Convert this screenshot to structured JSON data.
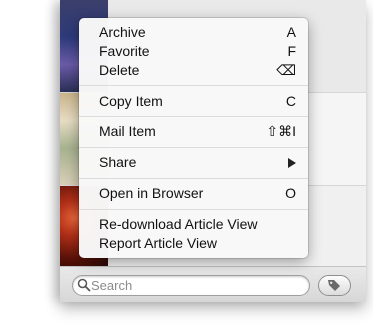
{
  "menu": {
    "archive": {
      "label": "Archive",
      "shortcut": "A"
    },
    "favorite": {
      "label": "Favorite",
      "shortcut": "F"
    },
    "delete": {
      "label": "Delete",
      "shortcut": "⌫"
    },
    "copy_item": {
      "label": "Copy Item",
      "shortcut": "C"
    },
    "mail_item": {
      "label": "Mail Item",
      "shortcut": "⇧⌘I"
    },
    "share": {
      "label": "Share"
    },
    "open_in_browser": {
      "label": "Open in Browser",
      "shortcut": "O"
    },
    "redownload": {
      "label": "Re-download Article View"
    },
    "report": {
      "label": "Report Article View"
    }
  },
  "search": {
    "placeholder": "Search"
  },
  "icons": {
    "search": "search-icon",
    "tag": "tag-icon",
    "submenu": "chevron-right-icon"
  }
}
